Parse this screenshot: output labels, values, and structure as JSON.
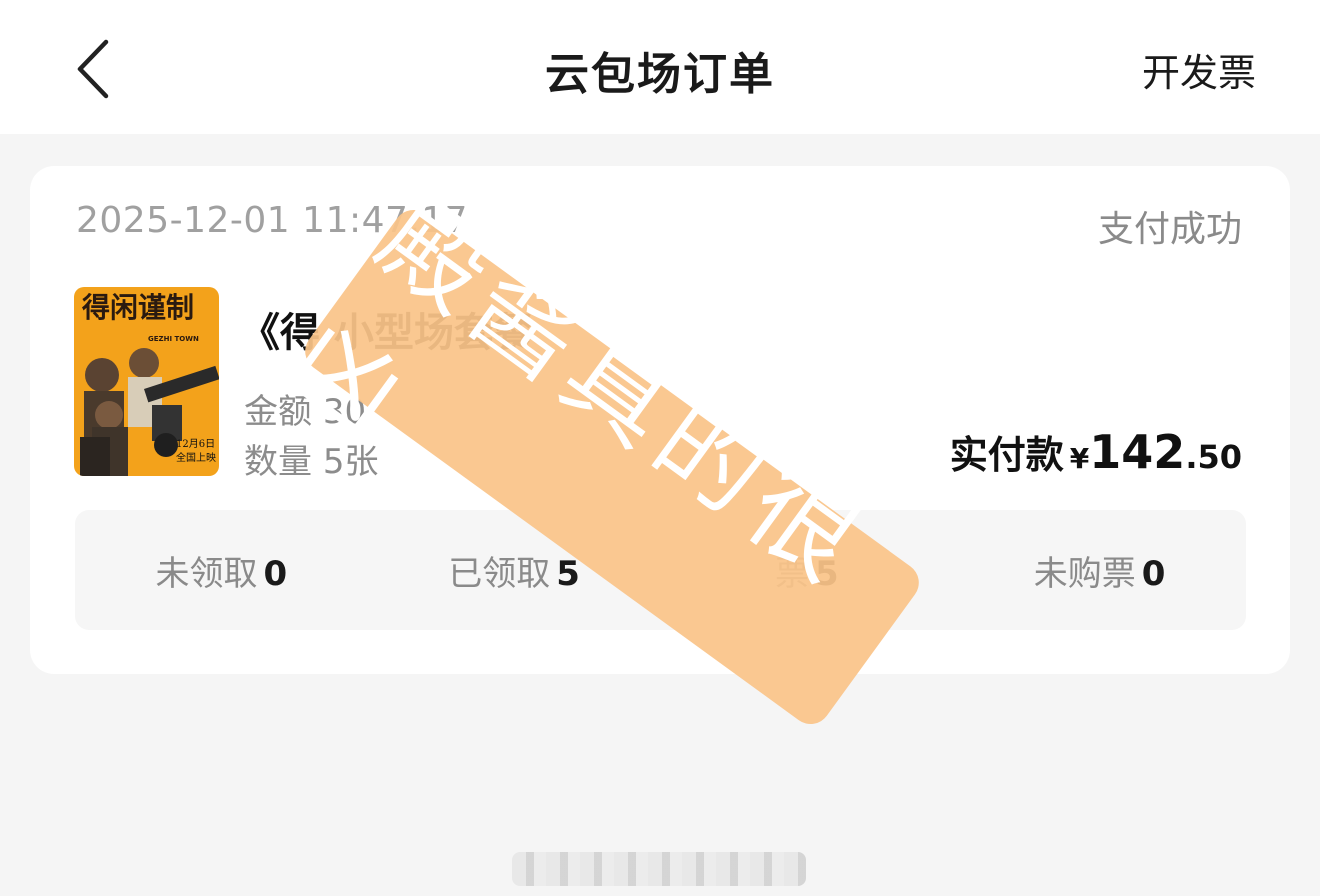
{
  "header": {
    "title": "云包场订单",
    "invoice_label": "开发票",
    "back_icon": "chevron-left-icon"
  },
  "order": {
    "time": "2025-12-01 11:47:17",
    "status": "支付成功",
    "product_name": "《得          小型场套餐",
    "amount_label": "金额",
    "amount_value": "30",
    "quantity_label": "数量",
    "quantity_value": "5张",
    "paid_label": "实付款",
    "currency": "¥",
    "paid_int": "142",
    "paid_dec": ".50"
  },
  "poster": {
    "title_text": "得闲谨制",
    "subtitle": "GEZHI TOWN",
    "date_text": "12月6日",
    "release_text": "全国上映",
    "bg_color": "#f3a21b"
  },
  "stats": [
    {
      "label": "未领取",
      "value": "0"
    },
    {
      "label": "已领取",
      "value": "5"
    },
    {
      "label": "票",
      "value": "5"
    },
    {
      "label": "未购票",
      "value": "0"
    }
  ],
  "watermark": {
    "text": "殿酱真的很凶",
    "color": "#fac489"
  }
}
